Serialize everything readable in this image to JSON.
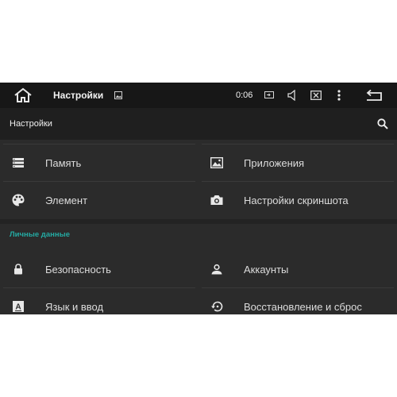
{
  "status_bar": {
    "title": "Настройки",
    "time": "0:06",
    "icons": [
      "home-icon",
      "gallery-icon",
      "screen-icon",
      "volume-icon",
      "close-box-icon",
      "overflow-menu-icon",
      "back-icon"
    ]
  },
  "action_bar": {
    "title": "Настройки",
    "search_icon": "search-icon"
  },
  "section_device": {
    "items": [
      {
        "label": "Память",
        "icon": "storage-icon"
      },
      {
        "label": "Приложения",
        "icon": "apps-icon"
      },
      {
        "label": "Элемент",
        "icon": "palette-icon"
      },
      {
        "label": "Настройки скриншота",
        "icon": "camera-icon"
      }
    ]
  },
  "section_personal": {
    "header": "Личные данные",
    "items": [
      {
        "label": "Безопасность",
        "icon": "lock-icon"
      },
      {
        "label": "Аккаунты",
        "icon": "account-icon"
      },
      {
        "label": "Язык и ввод",
        "icon": "language-icon"
      },
      {
        "label": "Восстановление и сброс",
        "icon": "restore-icon"
      }
    ]
  },
  "colors": {
    "accent": "#24a9a2",
    "background": "#2b2b2b",
    "status_bar": "#171717",
    "action_bar": "#1f1f1f"
  }
}
